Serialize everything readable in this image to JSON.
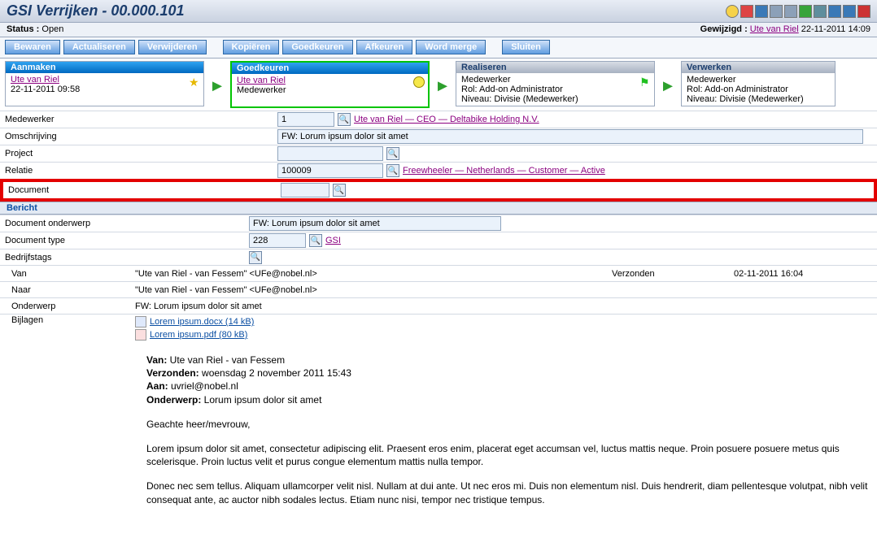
{
  "title": "GSI Verrijken - 00.000.101",
  "status_label": "Status :",
  "status_value": "Open",
  "modified_label": "Gewijzigd :",
  "modified_by": "Ute van Riel",
  "modified_at": "22-11-2011 14:09",
  "toolbar": {
    "bewaren": "Bewaren",
    "actualiseren": "Actualiseren",
    "verwijderen": "Verwijderen",
    "kopieren": "Kopiëren",
    "goedkeuren": "Goedkeuren",
    "afkeuren": "Afkeuren",
    "wordmerge": "Word merge",
    "sluiten": "Sluiten"
  },
  "workflow": {
    "aanmaken": {
      "title": "Aanmaken",
      "user": "Ute van Riel",
      "date": "22-11-2011 09:58"
    },
    "goedkeuren": {
      "title": "Goedkeuren",
      "user": "Ute van Riel",
      "role": "Medewerker"
    },
    "realiseren": {
      "title": "Realiseren",
      "line1": "Medewerker",
      "line2": "Rol: Add-on Administrator",
      "line3": "Niveau: Divisie (Medewerker)"
    },
    "verwerken": {
      "title": "Verwerken",
      "line1": "Medewerker",
      "line2": "Rol: Add-on Administrator",
      "line3": "Niveau: Divisie (Medewerker)"
    }
  },
  "fields": {
    "medewerker_lbl": "Medewerker",
    "medewerker_val": "1",
    "medewerker_link": "Ute van Riel — CEO — Deltabike Holding N.V.",
    "omschrijving_lbl": "Omschrijving",
    "omschrijving_val": "FW: Lorum ipsum dolor sit amet",
    "project_lbl": "Project",
    "project_val": "",
    "relatie_lbl": "Relatie",
    "relatie_val": "100009",
    "relatie_link": "Freewheeler — Netherlands — Customer — Active",
    "document_lbl": "Document",
    "document_val": ""
  },
  "bericht": {
    "header": "Bericht",
    "doc_onderwerp_lbl": "Document onderwerp",
    "doc_onderwerp_val": "FW: Lorum ipsum dolor sit amet",
    "doc_type_lbl": "Document type",
    "doc_type_val": "228",
    "doc_type_link": "GSI",
    "tags_lbl": "Bedrijfstags",
    "van_lbl": "Van",
    "van_val": "\"Ute van Riel - van Fessem\" <UFe@nobel.nl>",
    "verzonden_lbl": "Verzonden",
    "verzonden_val": "02-11-2011 16:04",
    "naar_lbl": "Naar",
    "naar_val": "\"Ute van Riel - van Fessem\" <UFe@nobel.nl>",
    "onderwerp_lbl": "Onderwerp",
    "onderwerp_val": "FW: Lorum ipsum dolor sit amet",
    "bijlagen_lbl": "Bijlagen",
    "attach1": "Lorem ipsum.docx (14 kB)",
    "attach2": "Lorem ipsum.pdf (80 kB)"
  },
  "email": {
    "van_lbl": "Van:",
    "van": " Ute van Riel - van Fessem",
    "verzonden_lbl": "Verzonden:",
    "verzonden": " woensdag 2 november 2011 15:43",
    "aan_lbl": "Aan:",
    "aan": " uvriel@nobel.nl",
    "onderwerp_lbl": "Onderwerp:",
    "onderwerp": " Lorum ipsum dolor sit amet",
    "greeting": "Geachte heer/mevrouw,",
    "para1": "Lorem ipsum dolor sit amet, consectetur adipiscing elit. Praesent eros enim, placerat eget accumsan vel, luctus mattis neque. Proin posuere posuere metus quis scelerisque. Proin luctus velit et purus congue elementum mattis nulla tempor.",
    "para2": "Donec nec sem tellus. Aliquam ullamcorper velit nisl. Nullam at dui ante. Ut nec eros mi. Duis non elementum nisl. Duis hendrerit, diam pellentesque volutpat, nibh velit consequat ante, ac auctor nibh sodales lectus. Etiam nunc nisi, tempor nec tristique tempus."
  }
}
